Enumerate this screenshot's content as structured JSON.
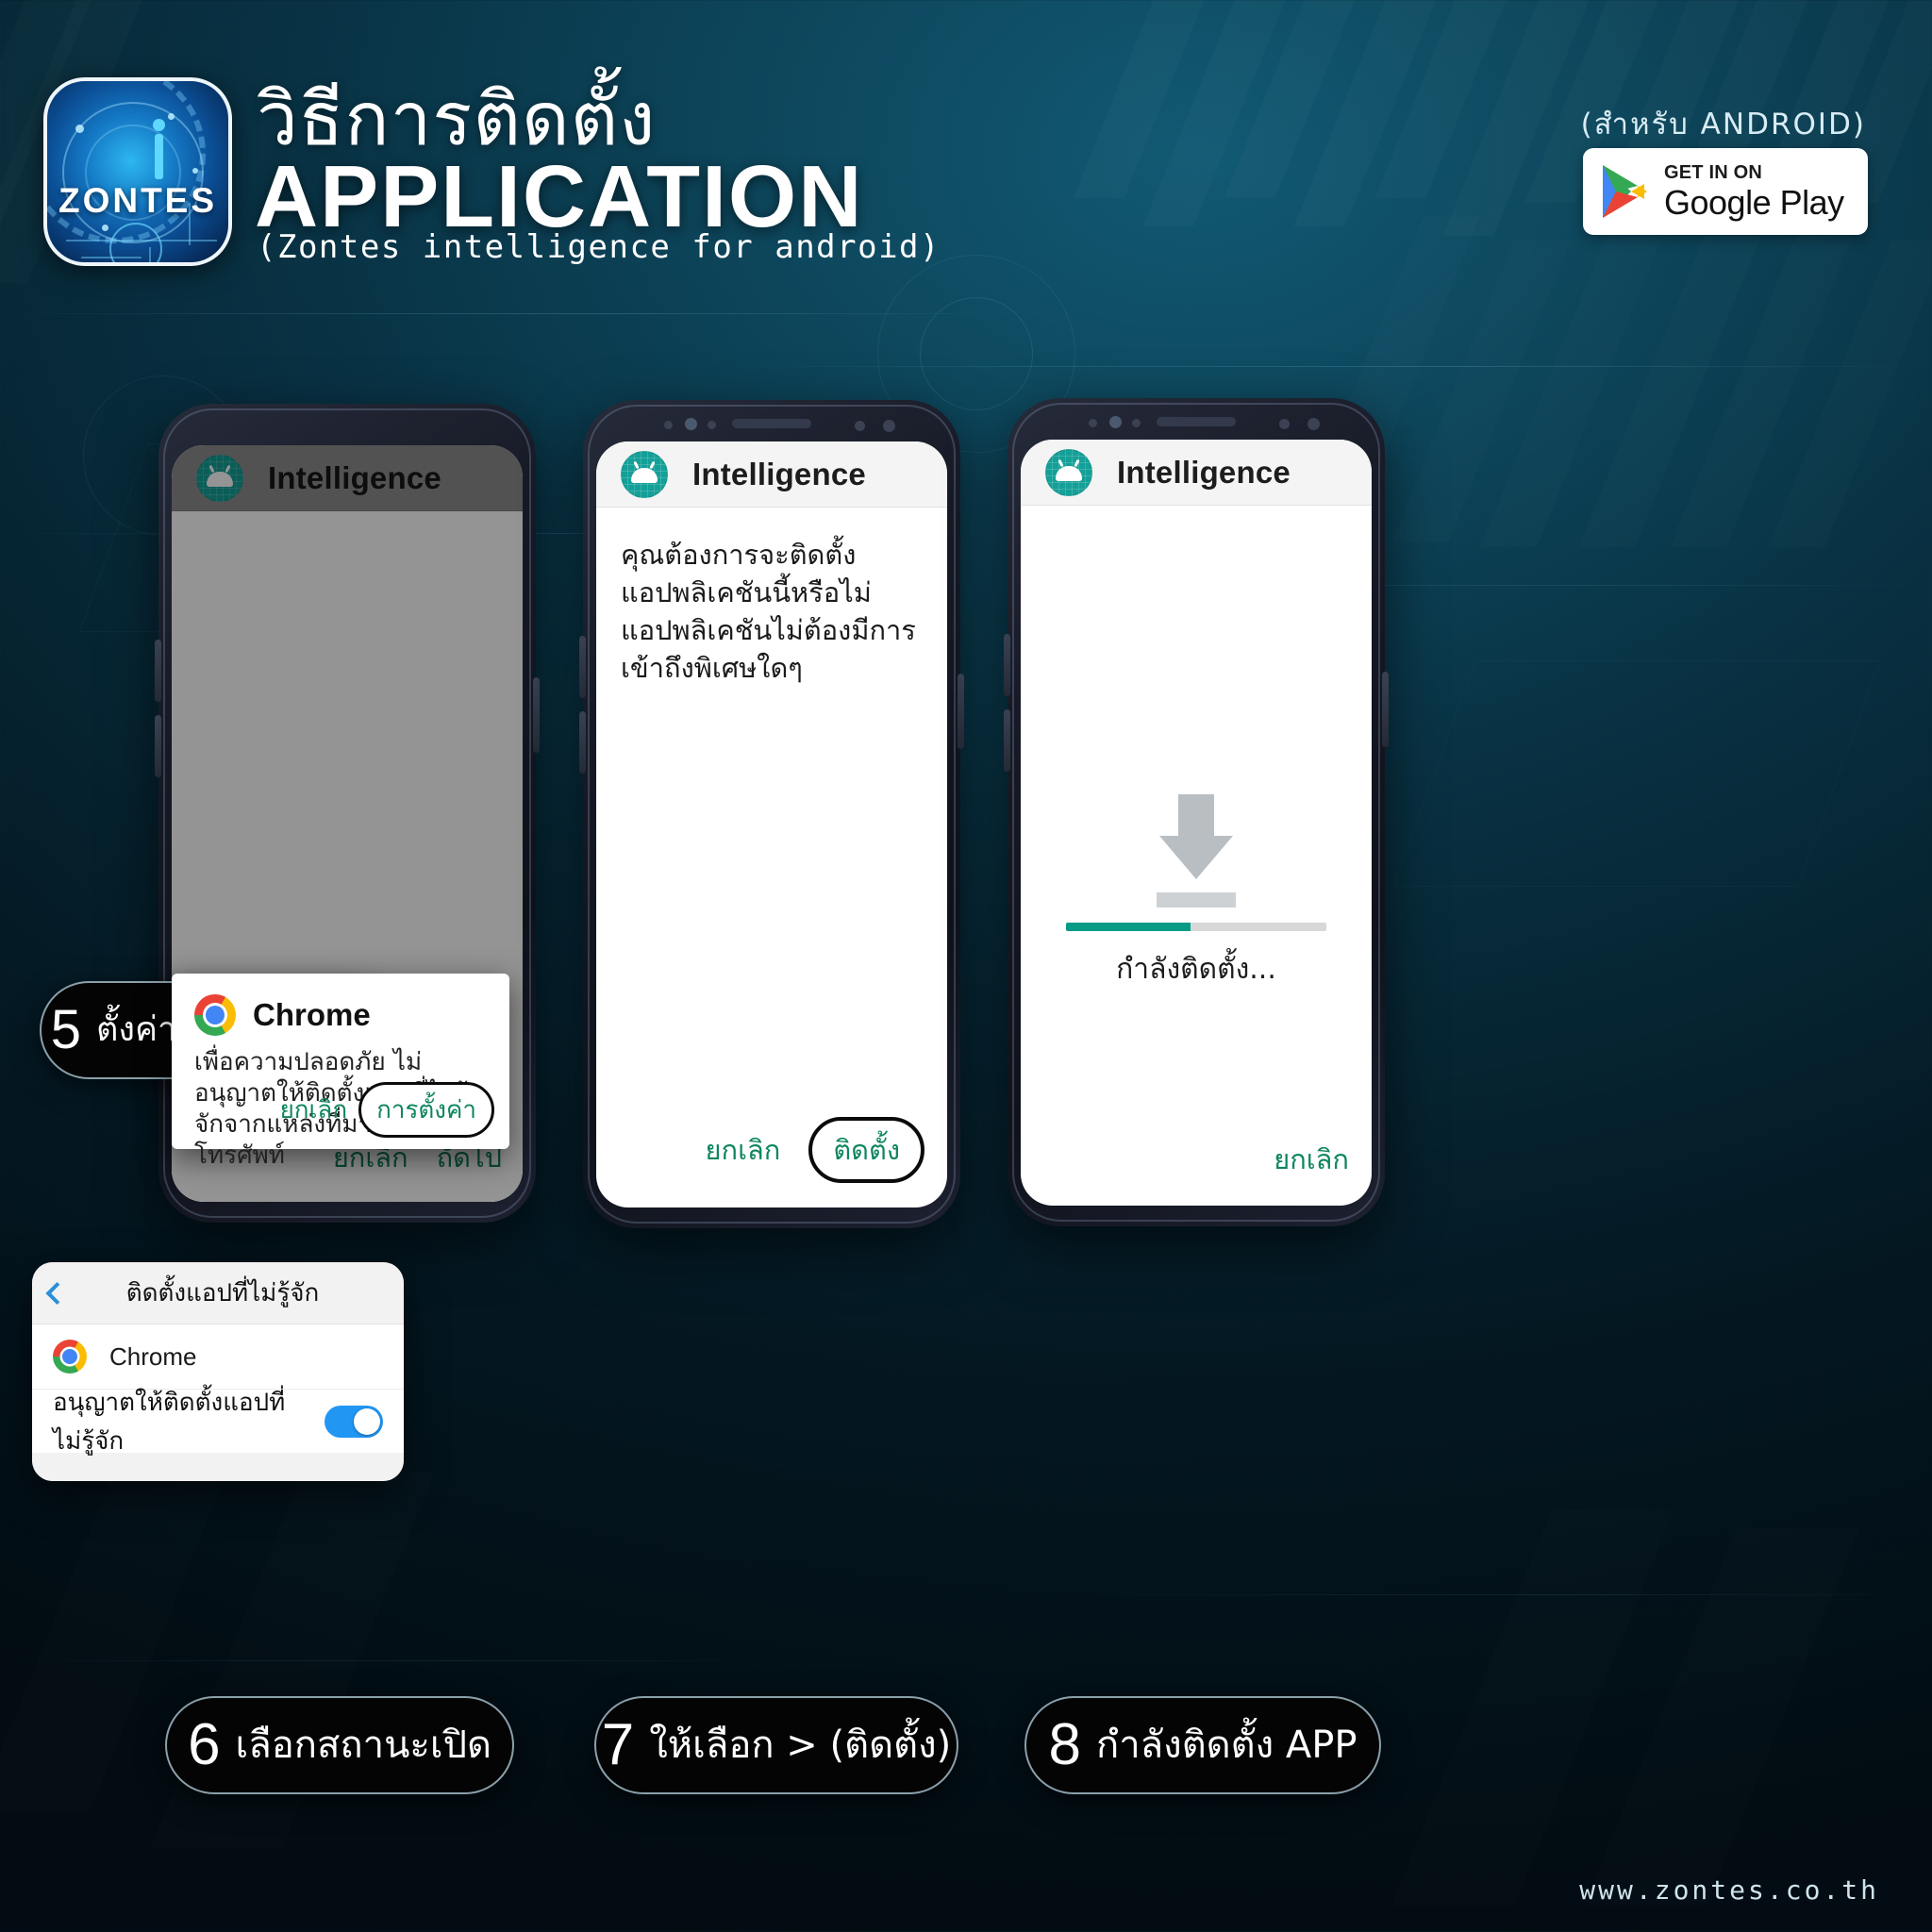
{
  "header": {
    "logo_word": "ZONTES",
    "title_thai": "วิธีการติดตั้ง",
    "title_main": "APPLICATION",
    "title_sub": "(Zontes intelligence for android)",
    "android_note": "(สำหรับ ANDROID)",
    "google_play": {
      "top_label": "GET IN ON",
      "bottom_label": "Google Play"
    }
  },
  "phones": [
    {
      "id": "phone-1",
      "appbar_title": "Intelligence",
      "chrome_dialog": {
        "app_name": "Chrome",
        "message": "เพื่อความปลอดภัย ไม่อนุญาตให้ติดตั้งแอปที่ไม่รู้จักจากแหล่งที่มานี้ในโทรศัพท์",
        "cancel_label": "ยกเลิก",
        "settings_label": "การตั้งค่า"
      },
      "settings_sheet": {
        "title": "ติดตั้งแอปที่ไม่รู้จัก",
        "app_row_label": "Chrome",
        "toggle_label": "อนุญาตให้ติดตั้งแอปที่ไม่รู้จัก",
        "toggle_state": "on"
      },
      "background_buttons": {
        "cancel_label": "ยกเลิก",
        "next_label": "ถัดไป"
      }
    },
    {
      "id": "phone-2",
      "appbar_title": "Intelligence",
      "message": "คุณต้องการจะติดตั้งแอปพลิเคชันนี้หรือไม่ แอปพลิเคชันไม่ต้องมีการเข้าถึงพิเศษใดๆ",
      "cancel_label": "ยกเลิก",
      "install_label": "ติดตั้ง"
    },
    {
      "id": "phone-3",
      "appbar_title": "Intelligence",
      "installing_label": "กำลังติดตั้ง...",
      "progress_percent": 48,
      "cancel_label": "ยกเลิก"
    }
  ],
  "steps": [
    {
      "number": "5",
      "label": "ตั้งค่าความปลอดภัย"
    },
    {
      "number": "6",
      "label": "เลือกสถานะเปิด"
    },
    {
      "number": "7",
      "label": "ให้เลือก > (ติดตั้ง)"
    },
    {
      "number": "8",
      "label": "กำลังติดตั้ง APP"
    }
  ],
  "footer": {
    "url": "www.zontes.co.th"
  },
  "colors": {
    "background_deep": "#03151f",
    "background_teal": "#0a3346",
    "accent_teal": "#069b84",
    "toggle_blue": "#2196f3",
    "dialog_green": "#0f8560",
    "droid_teal": "#14a098"
  }
}
